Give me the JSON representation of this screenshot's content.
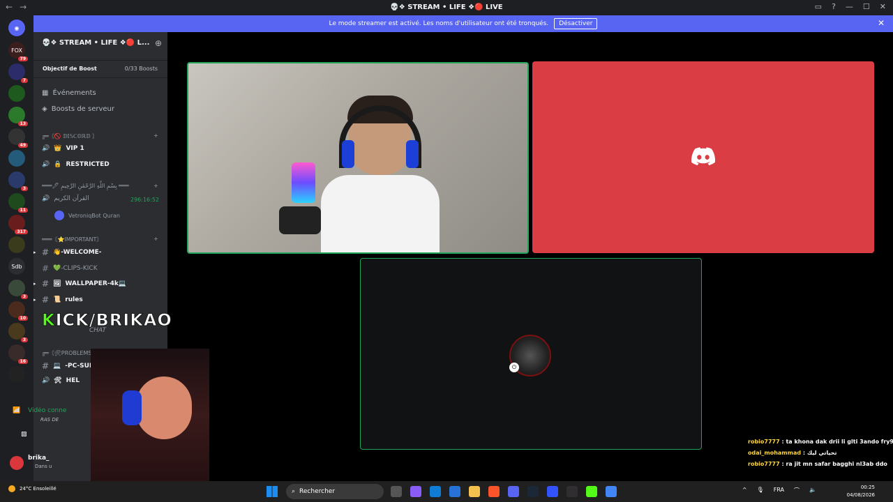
{
  "window": {
    "title": "💀❖ STREAM • LIFE ❖🔴 LIVE"
  },
  "banner": {
    "text": "Le mode streamer est activé. Les noms d'utilisateur ont été tronqués.",
    "button": "Désactiver"
  },
  "guilds": [
    {
      "label": "FOX",
      "badge": "79"
    },
    {
      "label": "",
      "badge": "7"
    },
    {
      "label": "",
      "badge": ""
    },
    {
      "label": "",
      "badge": "13"
    },
    {
      "label": "",
      "badge": "49"
    },
    {
      "label": "",
      "badge": ""
    },
    {
      "label": "",
      "badge": "3"
    },
    {
      "label": "",
      "badge": "11"
    },
    {
      "label": "",
      "badge": "317"
    },
    {
      "label": "",
      "badge": ""
    },
    {
      "label": "Sdb",
      "badge": ""
    },
    {
      "label": "",
      "badge": "3"
    },
    {
      "label": "",
      "badge": "10"
    },
    {
      "label": "",
      "badge": "3"
    },
    {
      "label": "",
      "badge": "16"
    },
    {
      "label": "",
      "badge": ""
    }
  ],
  "sidebar": {
    "server_name": "💀❖ STREAM • LIFE ❖🔴 L...",
    "boost_goal": "Objectif de Boost",
    "boost_count": "0/33 Boosts",
    "events": "Événements",
    "server_boosts": "Boosts de serveur",
    "cat1": "╔═〘🚫 𝔻𝕀𝕊ℂ𝕆ℝ𝔻 〙",
    "vip": "VIP 1",
    "restricted": "RESTRICTED",
    "cat2": "═══🖊 بِسْمِ اللَّهِ الرَّحْمَٰنِ الرَّحِيمِ ═══",
    "quran_channel": "القرآن الكريم",
    "quran_timer": "296:16:52",
    "quran_bot": "VetroniqBot Quran",
    "cat3": "═══〘⭐IMPORTANT〙",
    "welcome": "👋-WELCOME-",
    "clips": "💚-CLIPS-KICK",
    "wallpaper": "WALLPAPER-4k💻",
    "rules": "rules",
    "chat": "CHAT",
    "cat4": "╔═〘🛠PROBLEMS〙",
    "pc_support": "-PC-SUPPORT",
    "help": "HEL"
  },
  "overlay": {
    "k": "K",
    "rest": "ICK/BRIKAO"
  },
  "voice": {
    "connected": "Vidéo conne",
    "sub": "RAS DE"
  },
  "user": {
    "name": "brika_",
    "status": "Dans u"
  },
  "chat": [
    {
      "user": "robio7777",
      "msg": " : ta khona dak drii li glti 3ando fry9a wa"
    },
    {
      "user": "odai_mohammad",
      "msg": " : تحياتي ليك"
    },
    {
      "user": "robio7777",
      "msg": " : ra jit mn safar bagghi nl3ab ddo"
    }
  ],
  "taskbar": {
    "weather_temp": "24°C",
    "weather_desc": "Ensoleillé",
    "search": "Rechercher",
    "lang": "FRA",
    "time": "00:25",
    "date": "04/08/2026"
  },
  "colors": {
    "accent": "#5865f2",
    "speaking": "#23a55a",
    "discord_red": "#da3e44",
    "kick_green": "#53fc18"
  }
}
